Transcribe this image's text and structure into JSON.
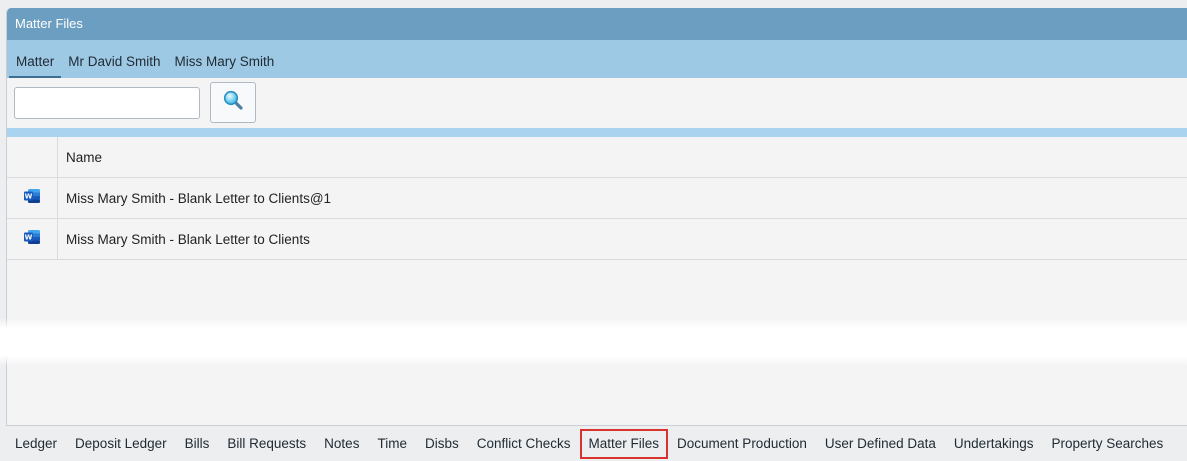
{
  "window": {
    "title": "Matter Files"
  },
  "tabs": [
    {
      "label": "Matter",
      "active": true
    },
    {
      "label": "Mr David Smith",
      "active": false
    },
    {
      "label": "Miss Mary Smith",
      "active": false
    }
  ],
  "search": {
    "value": "",
    "placeholder": "",
    "button_icon": "search-icon"
  },
  "grid": {
    "header": {
      "name": "Name"
    },
    "rows": [
      {
        "icon": "word-document-icon",
        "name": "Miss Mary Smith - Blank Letter to Clients@1"
      },
      {
        "icon": "word-document-icon",
        "name": "Miss Mary Smith - Blank Letter to Clients"
      }
    ]
  },
  "bottom_tabs": [
    {
      "label": "Ledger"
    },
    {
      "label": "Deposit Ledger"
    },
    {
      "label": "Bills"
    },
    {
      "label": "Bill Requests"
    },
    {
      "label": "Notes"
    },
    {
      "label": "Time"
    },
    {
      "label": "Disbs"
    },
    {
      "label": "Conflict Checks"
    },
    {
      "label": "Matter Files",
      "highlighted": true
    },
    {
      "label": "Document Production"
    },
    {
      "label": "User Defined Data"
    },
    {
      "label": "Undertakings"
    },
    {
      "label": "Property Searches"
    }
  ],
  "colors": {
    "titlebar": "#6b9ec1",
    "tabbar": "#9ec9e5",
    "highlight": "#d9332f",
    "word_blue": "#2b579a"
  }
}
